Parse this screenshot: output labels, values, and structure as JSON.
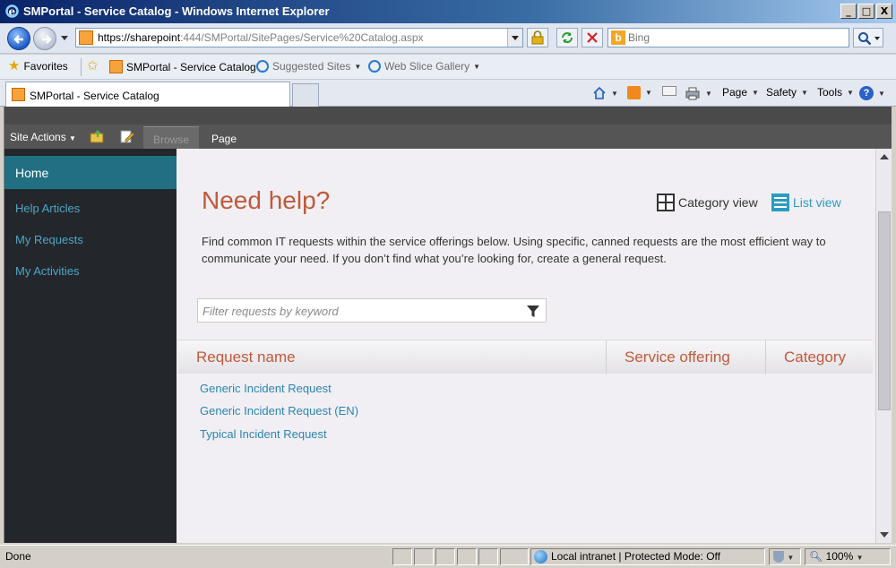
{
  "window": {
    "title": "SMPortal - Service Catalog - Windows Internet Explorer",
    "minimize_label": "_",
    "maximize_label": "□",
    "close_label": "X"
  },
  "address_bar": {
    "url_protocol_host": "https://sharepoint",
    "url_rest": ":444/SMPortal/SitePages/Service%20Catalog.aspx",
    "search_placeholder": "Bing"
  },
  "favorites_bar": {
    "favorites_label": "Favorites",
    "items": [
      {
        "label": "SMPortal - Service Catalog"
      },
      {
        "label": "Suggested Sites"
      },
      {
        "label": "Web Slice Gallery"
      }
    ]
  },
  "tabs": {
    "active_tab_label": "SMPortal - Service Catalog"
  },
  "command_bar": {
    "page_label": "Page",
    "safety_label": "Safety",
    "tools_label": "Tools"
  },
  "ribbon": {
    "site_actions_label": "Site Actions",
    "tabs": [
      {
        "label": "Browse"
      },
      {
        "label": "Page"
      }
    ]
  },
  "left_nav": {
    "home_label": "Home",
    "items": [
      {
        "label": "Help Articles"
      },
      {
        "label": "My Requests"
      },
      {
        "label": "My Activities"
      }
    ]
  },
  "main": {
    "title": "Need help?",
    "category_view_label": "Category view",
    "list_view_label": "List view",
    "description": "Find common IT requests within the service offerings below.  Using specific, canned requests are the most efficient way to communicate your need. If you don’t find what you’re looking for, create a general request.",
    "filter_placeholder": "Filter requests by keyword",
    "columns": {
      "request_name": "Request name",
      "service_offering": "Service offering",
      "category": "Category"
    },
    "requests": [
      {
        "name": "Generic Incident Request"
      },
      {
        "name": "Generic Incident Request (EN)"
      },
      {
        "name": "Typical Incident Request"
      }
    ]
  },
  "status_bar": {
    "status_text": "Done",
    "zone_text": "Local intranet | Protected Mode: Off",
    "zoom_text": "100%"
  },
  "colors": {
    "accent_orange": "#bf5a3a",
    "link_blue": "#2a85b1",
    "nav_bg": "#23272b",
    "nav_selected": "#216f83",
    "ribbon_bg": "#555555"
  }
}
